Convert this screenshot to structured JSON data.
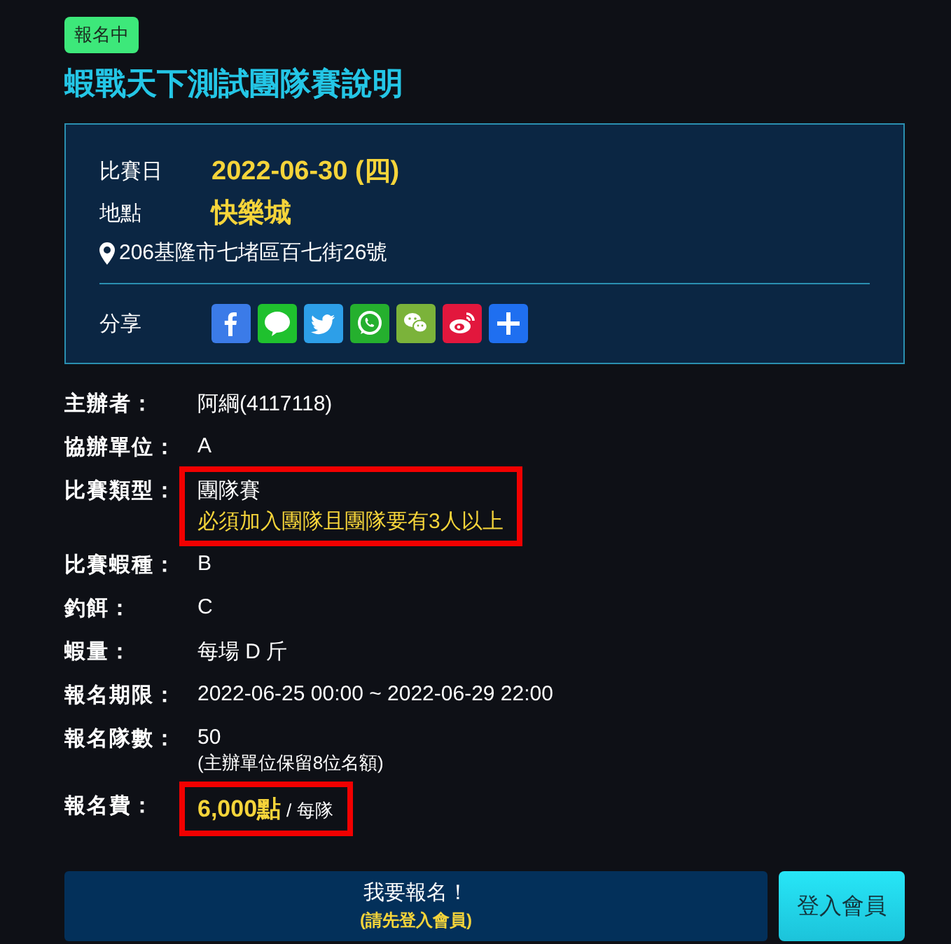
{
  "status_badge": "報名中",
  "title": "蝦戰天下測試團隊賽說明",
  "info_card": {
    "date_label": "比賽日",
    "date": "2022-06-30 (四)",
    "venue_label": "地點",
    "venue": "快樂城",
    "address": "206基隆市七堵區百七街26號",
    "share_label": "分享",
    "share_buttons": [
      {
        "kind": "facebook",
        "color": "#3b7be8"
      },
      {
        "kind": "line",
        "color": "#1fc12e"
      },
      {
        "kind": "twitter",
        "color": "#2d9fe8"
      },
      {
        "kind": "whatsapp",
        "color": "#25b02e"
      },
      {
        "kind": "wechat",
        "color": "#7bb33a"
      },
      {
        "kind": "weibo",
        "color": "#e2173d"
      },
      {
        "kind": "more",
        "color": "#1f6ff0"
      }
    ]
  },
  "details": [
    {
      "label": "主辦者：",
      "value": "阿綱(4117118)",
      "highlighted": false
    },
    {
      "label": "協辦單位：",
      "value": "A",
      "highlighted": false
    },
    {
      "label": "比賽類型：",
      "value": "團隊賽",
      "note": "必須加入團隊且團隊要有3人以上",
      "highlighted": true
    },
    {
      "label": "比賽蝦種：",
      "value": "B",
      "highlighted": false
    },
    {
      "label": "釣餌：",
      "value": "C",
      "highlighted": false
    },
    {
      "label": "蝦量：",
      "value": "每場 D 斤",
      "highlighted": false
    },
    {
      "label": "報名期限：",
      "value": "2022-06-25 00:00 ~ 2022-06-29 22:00",
      "highlighted": false
    },
    {
      "label": "報名隊數：",
      "value": "50",
      "sub": "(主辦單位保留8位名額)",
      "highlighted": false
    },
    {
      "label": "報名費：",
      "price": "6,000點",
      "unit": "/ 每隊",
      "highlighted": true
    }
  ],
  "register_button": {
    "label": "我要報名！",
    "hint": "(請先登入會員)"
  },
  "login_button": "登入會員"
}
